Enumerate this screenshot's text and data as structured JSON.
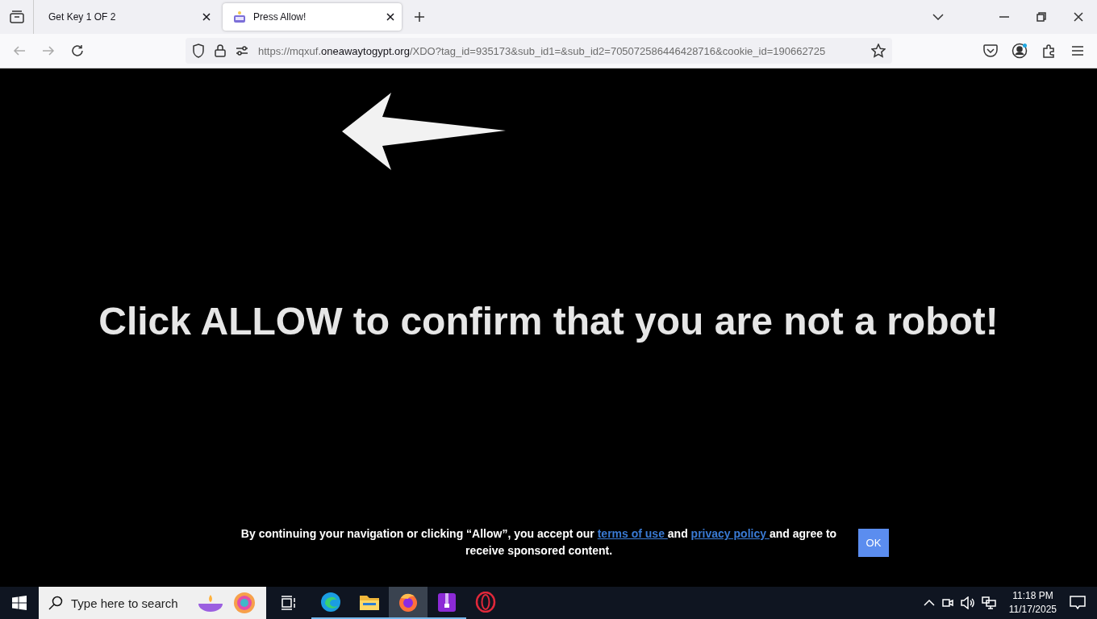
{
  "tabs": [
    {
      "label": "Get Key 1 OF 2",
      "selected": false,
      "kind": "plain"
    },
    {
      "label": "Press Allow!",
      "selected": true,
      "kind": "robot"
    }
  ],
  "address_bar": {
    "scheme": "https://mqxuf.",
    "host": "oneawaytogypt.org",
    "path": "/XDO?tag_id=935173&sub_id1=&sub_id2=705072586446428716&cookie_id=190662725"
  },
  "page": {
    "headline": "Click ALLOW to confirm that you are not a robot!",
    "consent": {
      "before": "By continuing your navigation or clicking “Allow”, you accept our ",
      "terms_link": "terms of use ",
      "middle": " and ",
      "privacy_link": "privacy policy ",
      "after": "and agree to receive sponsored content.",
      "button": "OK"
    }
  },
  "taskbar": {
    "search_placeholder": "Type here to search",
    "apps": [
      {
        "kind": "edge",
        "selected": false,
        "running": true
      },
      {
        "kind": "folder",
        "selected": false,
        "running": true
      },
      {
        "kind": "firefox",
        "selected": true,
        "running": true
      },
      {
        "kind": "archive",
        "selected": false,
        "running": true
      },
      {
        "kind": "opera",
        "selected": false,
        "running": false
      }
    ],
    "time": "11:18 PM",
    "date": "11/17/2025"
  }
}
